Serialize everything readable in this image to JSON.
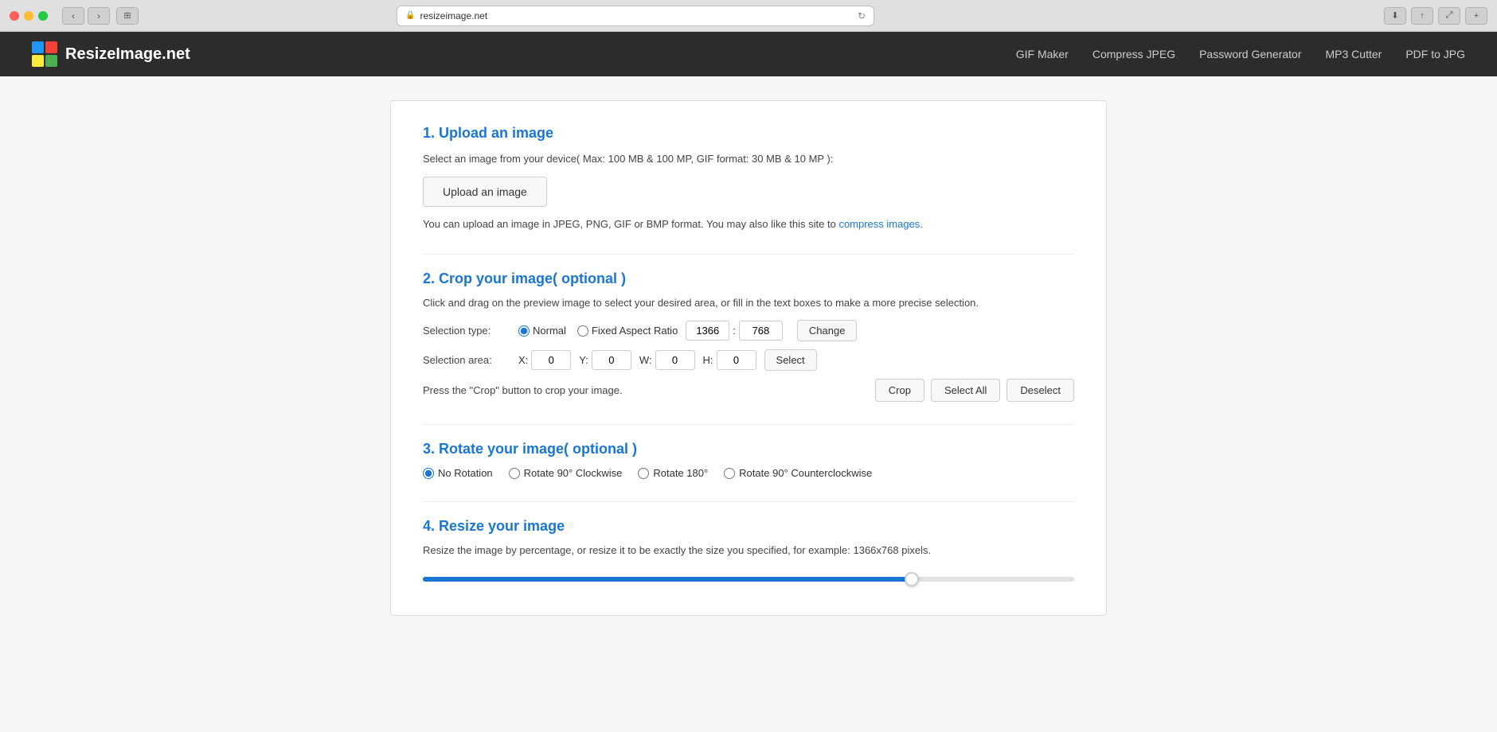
{
  "browser": {
    "url": "resizeimage.net",
    "back_icon": "‹",
    "forward_icon": "›",
    "reader_icon": "⊞",
    "reload_icon": "↻",
    "share_icon": "↑",
    "fullscreen_icon": "⤢",
    "add_tab_icon": "+"
  },
  "site": {
    "logo_text": "ResizeImage.net",
    "nav_links": [
      {
        "label": "GIF Maker"
      },
      {
        "label": "Compress JPEG"
      },
      {
        "label": "Password Generator"
      },
      {
        "label": "MP3 Cutter"
      },
      {
        "label": "PDF to JPG"
      }
    ]
  },
  "page": {
    "section1": {
      "title": "1. Upload an image",
      "desc": "Select an image from your device( Max: 100 MB & 100 MP, GIF format: 30 MB & 10 MP ):",
      "upload_btn": "Upload an image",
      "note": "You can upload an image in JPEG, PNG, GIF or BMP format. You may also like this site to ",
      "note_link": "compress images",
      "note_end": "."
    },
    "section2": {
      "title": "2. Crop your image( optional )",
      "desc": "Click and drag on the preview image to select your desired area, or fill in the text boxes to make a more precise selection.",
      "selection_type_label": "Selection type:",
      "radio_normal": "Normal",
      "radio_fixed": "Fixed Aspect Ratio",
      "ratio_w": "1366",
      "ratio_sep": ":",
      "ratio_h": "768",
      "change_btn": "Change",
      "selection_area_label": "Selection area:",
      "x_label": "X:",
      "x_val": "0",
      "y_label": "Y:",
      "y_val": "0",
      "w_label": "W:",
      "w_val": "0",
      "h_label": "H:",
      "h_val": "0",
      "select_btn": "Select",
      "press_desc": "Press the \"Crop\" button to crop your image.",
      "crop_btn": "Crop",
      "select_all_btn": "Select All",
      "deselect_btn": "Deselect"
    },
    "section3": {
      "title": "3. Rotate your image( optional )",
      "options": [
        {
          "label": "No Rotation",
          "value": "none",
          "checked": true
        },
        {
          "label": "Rotate 90° Clockwise",
          "value": "cw90",
          "checked": false
        },
        {
          "label": "Rotate 180°",
          "value": "180",
          "checked": false
        },
        {
          "label": "Rotate 90° Counterclockwise",
          "value": "ccw90",
          "checked": false
        }
      ]
    },
    "section4": {
      "title": "4. Resize your image",
      "desc": "Resize the image by percentage, or resize it to be exactly the size you specified, for example: 1366x768 pixels.",
      "slider_value": 75
    }
  }
}
